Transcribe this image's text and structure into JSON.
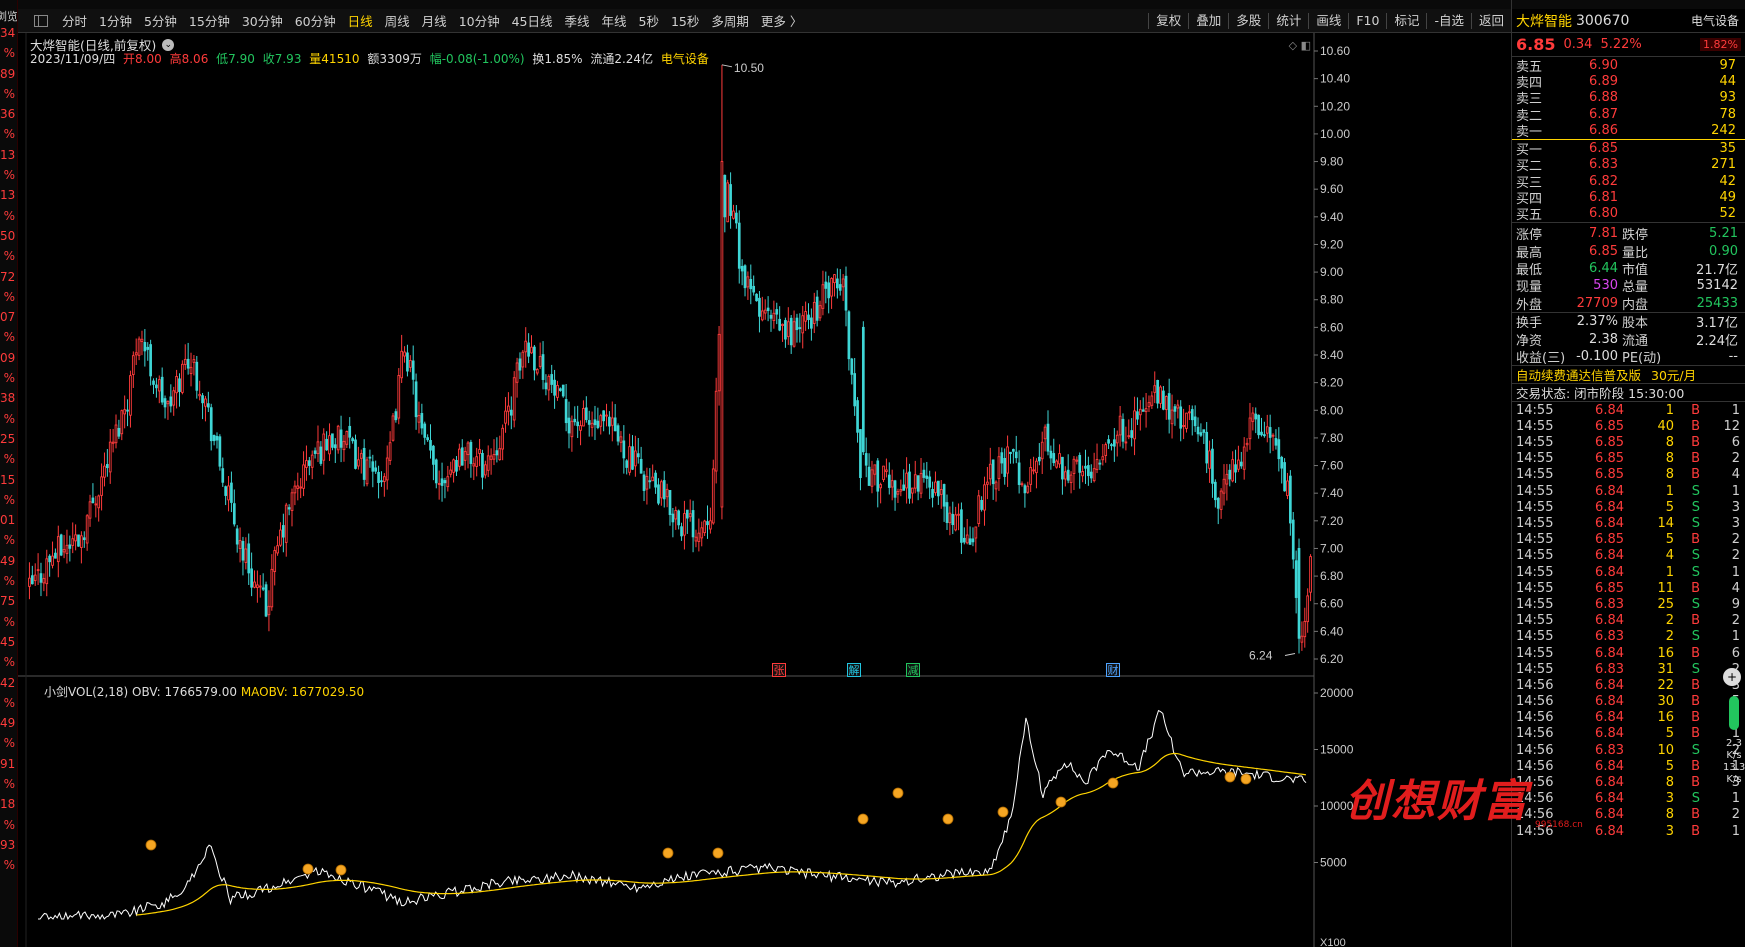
{
  "left_strip": {
    "top": "浏览",
    "values": [
      "34",
      "%",
      "89",
      "%",
      "36",
      "%",
      "13",
      "%",
      "13",
      "%",
      "50",
      "%",
      "72",
      "%",
      "07",
      "%",
      "09",
      "%",
      "38",
      "%",
      "25",
      "%",
      "15",
      "%",
      "01",
      "%",
      "49",
      "%",
      "75",
      "%",
      "45",
      "%",
      "42",
      "%",
      "49",
      "%",
      "91",
      "%",
      "18",
      "%",
      "93",
      "%"
    ]
  },
  "toolbar": {
    "periods": [
      "分时",
      "1分钟",
      "5分钟",
      "15分钟",
      "30分钟",
      "60分钟",
      "日线",
      "周线",
      "月线",
      "10分钟",
      "45日线",
      "季线",
      "年线",
      "5秒",
      "15秒",
      "多周期",
      "更多 〉"
    ],
    "active_period": "日线",
    "tools": [
      "复权",
      "叠加",
      "多股",
      "统计",
      "画线",
      "F10",
      "标记",
      "-自选",
      "返回"
    ]
  },
  "chart_title": {
    "text": "大烨智能(日线,前复权)",
    "circle": "⌄"
  },
  "info": {
    "date": "2023/11/09/四",
    "open": "开8.00",
    "high": "高8.06",
    "low": "低7.90",
    "close": "收7.93",
    "volume": "量41510",
    "amount": "额3309万",
    "change": "幅-0.08(-1.00%)",
    "turnover": "换1.85%",
    "float": "流通2.24亿",
    "sector": "电气设备"
  },
  "indicator": {
    "name": "小剑VOL(2,18)",
    "obv": "OBV: 1766579.00",
    "maobv": "MAOBV: 1677029.50"
  },
  "markers": [
    {
      "text": "张",
      "color": "#ff3b3b"
    },
    {
      "text": "解",
      "color": "#22c5e0"
    },
    {
      "text": "减",
      "color": "#22c55e"
    },
    {
      "text": "财",
      "color": "#4fa3ff"
    }
  ],
  "y_axis_price": [
    "10.60",
    "10.40",
    "10.20",
    "10.00",
    "9.80",
    "9.60",
    "9.40",
    "9.20",
    "9.00",
    "8.80",
    "8.60",
    "8.40",
    "8.20",
    "8.00",
    "7.80",
    "7.60",
    "7.40",
    "7.20",
    "7.00",
    "6.80",
    "6.60",
    "6.40",
    "6.20"
  ],
  "y_axis_obv": [
    "20000",
    "15000",
    "10000",
    "5000",
    "X100"
  ],
  "price_labels": {
    "high": "10.50",
    "low": "6.24"
  },
  "chart_data": {
    "type": "candlestick",
    "title": "大烨智能(日线,前复权)",
    "ylim": [
      6.2,
      10.6
    ],
    "candles_sample": [
      {
        "o": 6.62,
        "h": 6.85,
        "l": 6.55,
        "c": 6.78
      },
      {
        "o": 7.9,
        "h": 9.2,
        "l": 7.6,
        "c": 8.9
      },
      {
        "o": 6.7,
        "h": 7.3,
        "l": 6.45,
        "c": 7.2
      },
      {
        "o": 8.0,
        "h": 10.5,
        "l": 7.2,
        "c": 9.8
      },
      {
        "o": 8.9,
        "h": 9.25,
        "l": 7.8,
        "c": 7.6
      },
      {
        "o": 7.93,
        "h": 8.06,
        "l": 6.24,
        "c": 6.85
      }
    ],
    "high_mark": 10.5,
    "low_mark": 6.24,
    "indicator": {
      "name": "小剑VOL(2,18)",
      "obv_last": 1766579.0,
      "maobv_last": 1677029.5,
      "ylim": [
        0,
        20000
      ],
      "unit": "X100"
    }
  },
  "panel": {
    "name": "大烨智能",
    "code": "300670",
    "sector": "电气设备",
    "price": "6.85",
    "change": "0.34",
    "pct": "5.22%",
    "sector_pct": "1.82%",
    "sell": [
      {
        "label": "卖五",
        "price": "6.90",
        "vol": "97"
      },
      {
        "label": "卖四",
        "price": "6.89",
        "vol": "44"
      },
      {
        "label": "卖三",
        "price": "6.88",
        "vol": "93"
      },
      {
        "label": "卖二",
        "price": "6.87",
        "vol": "78"
      },
      {
        "label": "卖一",
        "price": "6.86",
        "vol": "242"
      }
    ],
    "buy": [
      {
        "label": "买一",
        "price": "6.85",
        "vol": "35"
      },
      {
        "label": "买二",
        "price": "6.83",
        "vol": "271"
      },
      {
        "label": "买三",
        "price": "6.82",
        "vol": "42"
      },
      {
        "label": "买四",
        "price": "6.81",
        "vol": "49"
      },
      {
        "label": "买五",
        "price": "6.80",
        "vol": "52"
      }
    ],
    "stats": [
      {
        "k1": "涨停",
        "v1": "7.81",
        "c1": "#ff3b3b",
        "k2": "跌停",
        "v2": "5.21",
        "c2": "#22c55e"
      },
      {
        "k1": "最高",
        "v1": "6.85",
        "c1": "#ff3b3b",
        "k2": "量比",
        "v2": "0.90",
        "c2": "#22c55e"
      },
      {
        "k1": "最低",
        "v1": "6.44",
        "c1": "#22c55e",
        "k2": "市值",
        "v2": "21.7亿",
        "c2": "#ddd"
      },
      {
        "k1": "现量",
        "v1": "530",
        "c1": "#d946ef",
        "k2": "总量",
        "v2": "53142",
        "c2": "#ddd"
      },
      {
        "k1": "外盘",
        "v1": "27709",
        "c1": "#ff3b3b",
        "k2": "内盘",
        "v2": "25433",
        "c2": "#22c55e"
      }
    ],
    "stats2": [
      {
        "k1": "换手",
        "v1": "2.37%",
        "c1": "#ddd",
        "k2": "股本",
        "v2": "3.17亿",
        "c2": "#ddd"
      },
      {
        "k1": "净资",
        "v1": "2.38",
        "c1": "#ddd",
        "k2": "流通",
        "v2": "2.24亿",
        "c2": "#ddd"
      },
      {
        "k1": "收益(三)",
        "v1": "-0.100",
        "c1": "#ddd",
        "k2": "PE(动)",
        "v2": "--",
        "c2": "#ddd"
      }
    ],
    "ad_text": "自动续费通达信普及版",
    "ad_price": "30元/月",
    "trade_status": "交易状态: 闭市阶段 15:30:00",
    "ticks": [
      {
        "t": "14:55",
        "p": "6.84",
        "v": "1",
        "d": "B",
        "x": "1"
      },
      {
        "t": "14:55",
        "p": "6.85",
        "v": "40",
        "d": "B",
        "x": "12"
      },
      {
        "t": "14:55",
        "p": "6.85",
        "v": "8",
        "d": "B",
        "x": "6"
      },
      {
        "t": "14:55",
        "p": "6.85",
        "v": "8",
        "d": "B",
        "x": "2"
      },
      {
        "t": "14:55",
        "p": "6.85",
        "v": "8",
        "d": "B",
        "x": "4"
      },
      {
        "t": "14:55",
        "p": "6.84",
        "v": "1",
        "d": "S",
        "x": "1"
      },
      {
        "t": "14:55",
        "p": "6.84",
        "v": "5",
        "d": "S",
        "x": "3"
      },
      {
        "t": "14:55",
        "p": "6.84",
        "v": "14",
        "d": "S",
        "x": "3"
      },
      {
        "t": "14:55",
        "p": "6.85",
        "v": "5",
        "d": "B",
        "x": "2"
      },
      {
        "t": "14:55",
        "p": "6.84",
        "v": "4",
        "d": "S",
        "x": "2"
      },
      {
        "t": "14:55",
        "p": "6.84",
        "v": "1",
        "d": "S",
        "x": "1"
      },
      {
        "t": "14:55",
        "p": "6.85",
        "v": "11",
        "d": "B",
        "x": "4"
      },
      {
        "t": "14:55",
        "p": "6.83",
        "v": "25",
        "d": "S",
        "x": "9"
      },
      {
        "t": "14:55",
        "p": "6.84",
        "v": "2",
        "d": "B",
        "x": "2"
      },
      {
        "t": "14:55",
        "p": "6.83",
        "v": "2",
        "d": "S",
        "x": "1"
      },
      {
        "t": "14:55",
        "p": "6.84",
        "v": "16",
        "d": "B",
        "x": "6"
      },
      {
        "t": "14:55",
        "p": "6.83",
        "v": "31",
        "d": "S",
        "x": "2"
      },
      {
        "t": "14:56",
        "p": "6.84",
        "v": "22",
        "d": "B",
        "x": "3"
      },
      {
        "t": "14:56",
        "p": "6.84",
        "v": "30",
        "d": "B",
        "x": "5"
      },
      {
        "t": "14:56",
        "p": "6.84",
        "v": "16",
        "d": "B",
        "x": "2"
      },
      {
        "t": "14:56",
        "p": "6.84",
        "v": "5",
        "d": "B",
        "x": "1"
      },
      {
        "t": "14:56",
        "p": "6.83",
        "v": "10",
        "d": "S",
        "x": "2"
      },
      {
        "t": "14:56",
        "p": "6.84",
        "v": "5",
        "d": "B",
        "x": "1"
      },
      {
        "t": "14:56",
        "p": "6.84",
        "v": "8",
        "d": "B",
        "x": "3"
      },
      {
        "t": "14:56",
        "p": "6.84",
        "v": "3",
        "d": "S",
        "x": "1"
      },
      {
        "t": "14:56",
        "p": "6.84",
        "v": "8",
        "d": "B",
        "x": "2"
      },
      {
        "t": "14:56",
        "p": "6.84",
        "v": "3",
        "d": "B",
        "x": "1"
      }
    ],
    "speed": [
      "2.3",
      "K/s",
      "13.3",
      "K/s"
    ]
  },
  "watermark": {
    "text": "创想财富",
    "sub": "995168.cn"
  },
  "colors": {
    "up": "#ff3b3b",
    "down": "#3fd6d6",
    "obv": "#ffffff",
    "maobv": "#ffd400",
    "background": "#000000"
  }
}
